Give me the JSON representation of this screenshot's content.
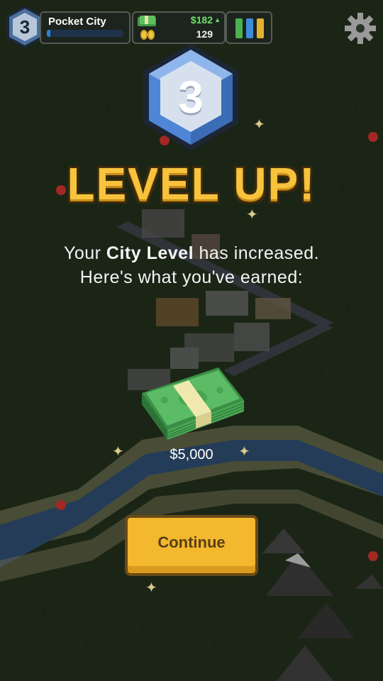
{
  "hud": {
    "level": "3",
    "city_name": "Pocket City",
    "xp_progress": 0.05,
    "money": "$182",
    "money_trend_icon": "up-arrow-icon",
    "population": "129",
    "settings_icon": "gear-icon",
    "stats_icon": "demand-bars-icon"
  },
  "popup": {
    "level": "3",
    "title": "LEVEL UP!",
    "line1_pre": "Your ",
    "line1_bold": "City Level",
    "line1_post": " has increased.",
    "line2": "Here's what you've earned:",
    "reward_icon": "cash-stack-icon",
    "reward_amount": "$5,000",
    "continue_label": "Continue"
  },
  "colors": {
    "title_gold": "#f7c33c",
    "button_yellow": "#f3b82e",
    "money_green": "#6fe06a",
    "badge_blue": "#4f86d8"
  }
}
